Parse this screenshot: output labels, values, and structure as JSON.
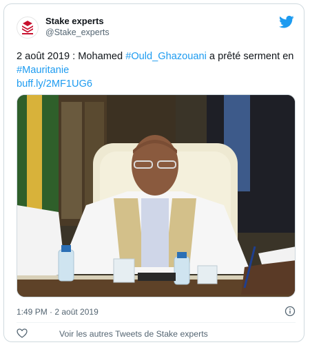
{
  "author": {
    "display_name": "Stake experts",
    "handle": "@Stake_experts"
  },
  "tweet": {
    "text_prefix": "2 août 2019 : Mohamed ",
    "hashtag_1": "#Ould_Ghazouani",
    "text_middle": " a prêté serment en ",
    "hashtag_2": "#Mauritanie",
    "link": "buff.ly/2MF1UG6"
  },
  "timestamp": "1:49 PM · 2 août 2019",
  "footer": {
    "more_tweets_label": "Voir les autres Tweets de Stake experts"
  },
  "icons": {
    "brand": "twitter-bird-icon",
    "info": "info-icon",
    "like": "heart-icon"
  },
  "colors": {
    "link": "#1d9bf0",
    "brand": "#1d9bf0",
    "muted": "#536471",
    "logo": "#c8102e"
  }
}
